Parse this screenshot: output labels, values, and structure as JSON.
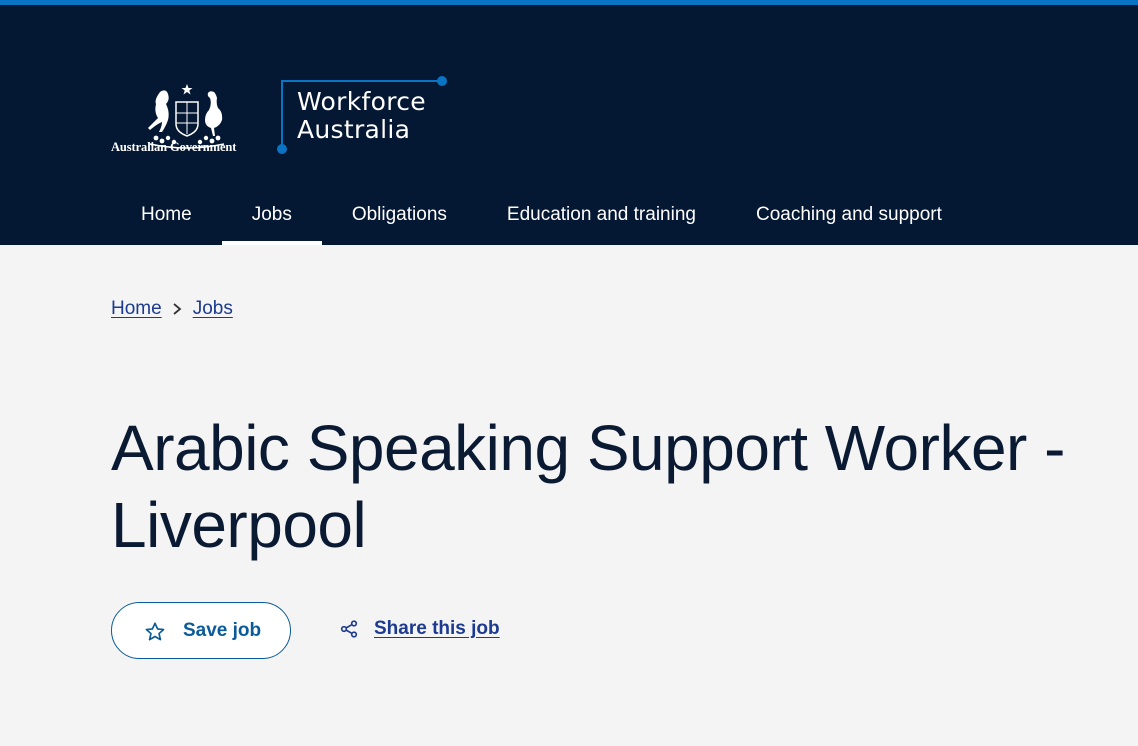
{
  "colors": {
    "header_bg": "#041733",
    "accent": "#0a74c4",
    "link": "#1c3a8f",
    "button_text": "#0a5b99",
    "title": "#0b1a33",
    "page_bg": "#f4f4f4"
  },
  "logo": {
    "government_text": "Australian Government",
    "brand_line1": "Workforce",
    "brand_line2": "Australia"
  },
  "nav": {
    "items": [
      {
        "label": "Home",
        "active": false
      },
      {
        "label": "Jobs",
        "active": true
      },
      {
        "label": "Obligations",
        "active": false
      },
      {
        "label": "Education and training",
        "active": false
      },
      {
        "label": "Coaching and support",
        "active": false
      }
    ]
  },
  "breadcrumb": {
    "items": [
      "Home",
      "Jobs"
    ],
    "separator_icon": "chevron-right-icon"
  },
  "job": {
    "title": "Arabic Speaking Support Worker - Liverpool"
  },
  "actions": {
    "save_label": "Save job",
    "save_icon": "star-outline-icon",
    "share_label": "Share this job",
    "share_icon": "share-icon"
  }
}
